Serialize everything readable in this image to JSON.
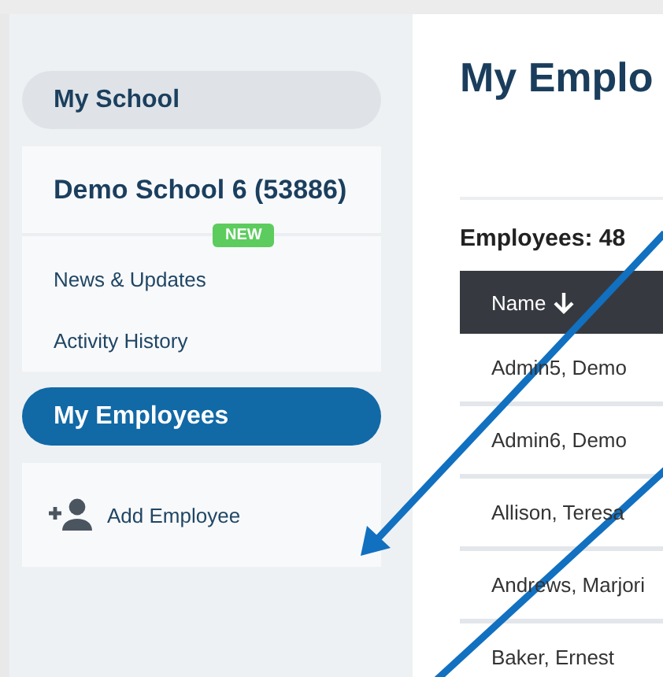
{
  "sidebar": {
    "sections": [
      {
        "title": "My School",
        "selected": false,
        "cards": [
          {
            "kind": "school",
            "name": "Demo School 6 (53886)",
            "badge": "NEW"
          },
          {
            "kind": "links",
            "items": [
              "News & Updates",
              "Activity History"
            ]
          }
        ]
      },
      {
        "title": "My Employees",
        "selected": true,
        "cards": [
          {
            "kind": "action",
            "label": "Add Employee"
          }
        ]
      }
    ]
  },
  "main": {
    "title": "My Emplo",
    "count_label": "Employees: 48",
    "table": {
      "columns": [
        {
          "label": "Name",
          "sorted": true
        }
      ],
      "rows": [
        [
          "Admin5, Demo"
        ],
        [
          "Admin6, Demo"
        ],
        [
          "Allison, Teresa"
        ],
        [
          "Andrews, Marjori"
        ],
        [
          "Baker, Ernest"
        ]
      ]
    }
  }
}
